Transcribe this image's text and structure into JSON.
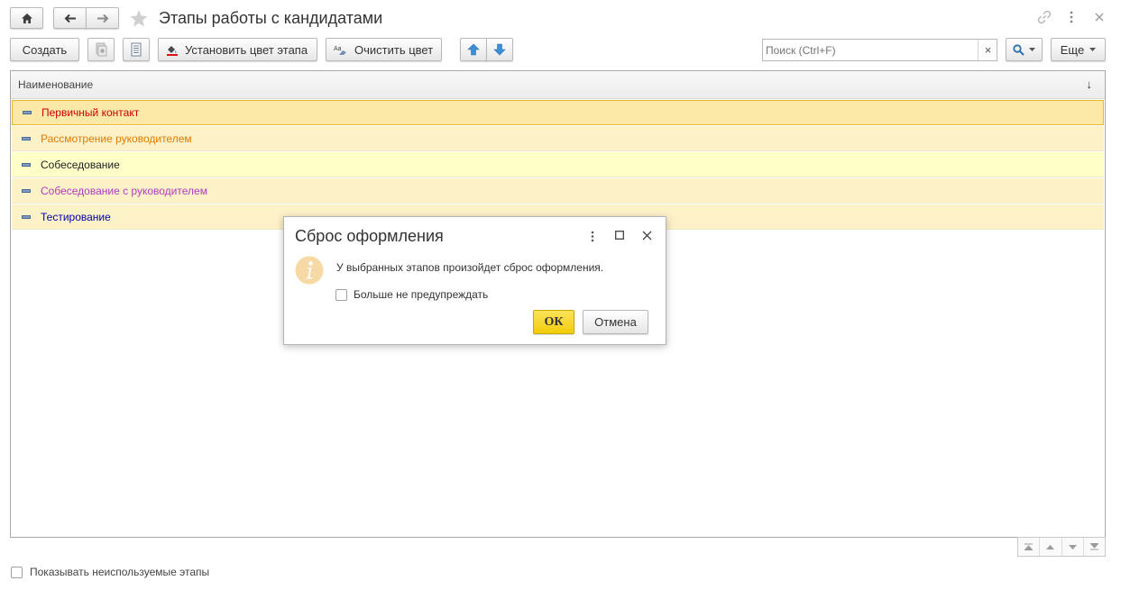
{
  "header": {
    "title": "Этапы работы с кандидатами"
  },
  "toolbar": {
    "create_label": "Создать",
    "set_color_label": "Установить цвет этапа",
    "clear_color_label": "Очистить цвет",
    "search_placeholder": "Поиск (Ctrl+F)",
    "search_clear": "×",
    "more_label": "Еще"
  },
  "table": {
    "column_header": "Наименование",
    "sort_indicator": "↓",
    "rows": [
      {
        "label": "Первичный контакт",
        "text_color": "#cc0000",
        "bg": "#fce9a8",
        "selected": true
      },
      {
        "label": "Рассмотрение руководителем",
        "text_color": "#e07b00",
        "bg": "#fdf1c8",
        "selected": false
      },
      {
        "label": "Собеседование",
        "text_color": "#222222",
        "bg": "#ffffc8",
        "selected": false
      },
      {
        "label": "Собеседование с руководителем",
        "text_color": "#b03cc0",
        "bg": "#fdf1c8",
        "selected": false
      },
      {
        "label": "Тестирование",
        "text_color": "#0000aa",
        "bg": "#fdf1c8",
        "selected": false
      }
    ]
  },
  "dialog": {
    "title": "Сброс оформления",
    "message": "У выбранных этапов произойдет сброс оформления.",
    "checkbox_label": "Больше не предупреждать",
    "ok_label": "ОК",
    "cancel_label": "Отмена"
  },
  "footer": {
    "show_unused_label": "Показывать неиспользуемые этапы"
  },
  "colors": {
    "accent_yellow": "#f5d21a",
    "selected_row_border": "#e8b830",
    "arrow_blue": "#3a8fd6"
  }
}
